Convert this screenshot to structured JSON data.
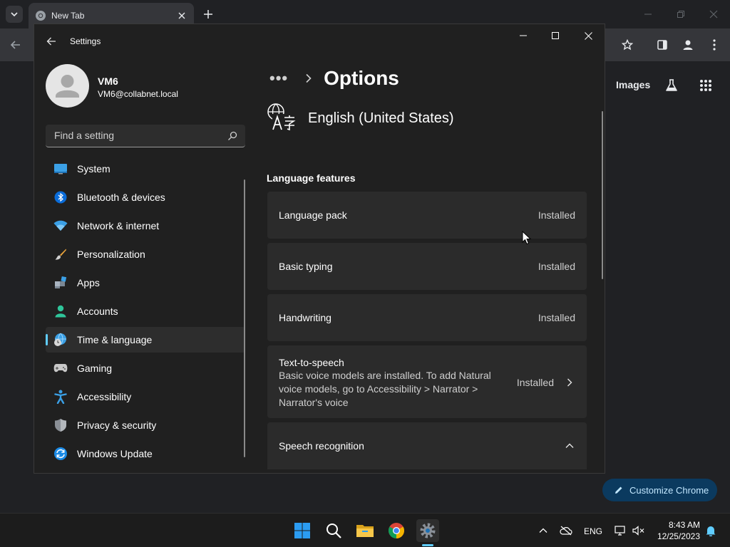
{
  "browser": {
    "tab": {
      "title": "New Tab"
    },
    "ntp": {
      "images_link": "Images",
      "customize_label": "Customize Chrome"
    }
  },
  "settings": {
    "title": "Settings",
    "profile": {
      "name": "VM6",
      "email": "VM6@collabnet.local"
    },
    "search": {
      "placeholder": "Find a setting"
    },
    "nav": [
      {
        "label": "System",
        "icon": "system-icon"
      },
      {
        "label": "Bluetooth & devices",
        "icon": "bluetooth-icon"
      },
      {
        "label": "Network & internet",
        "icon": "wifi-icon"
      },
      {
        "label": "Personalization",
        "icon": "brush-icon"
      },
      {
        "label": "Apps",
        "icon": "apps-icon"
      },
      {
        "label": "Accounts",
        "icon": "accounts-icon"
      },
      {
        "label": "Time & language",
        "icon": "time-language-icon",
        "selected": true
      },
      {
        "label": "Gaming",
        "icon": "gamepad-icon"
      },
      {
        "label": "Accessibility",
        "icon": "accessibility-icon"
      },
      {
        "label": "Privacy & security",
        "icon": "shield-icon"
      },
      {
        "label": "Windows Update",
        "icon": "update-icon"
      }
    ],
    "breadcrumb": {
      "ellipsis": "•••",
      "page_title": "Options"
    },
    "language": {
      "name": "English (United States)"
    },
    "section_title": "Language features",
    "features": [
      {
        "label": "Language pack",
        "status": "Installed"
      },
      {
        "label": "Basic typing",
        "status": "Installed"
      },
      {
        "label": "Handwriting",
        "status": "Installed"
      },
      {
        "label": "Text-to-speech",
        "description": "Basic voice models are installed. To add Natural voice models, go to Accessibility > Narrator > Narrator's voice",
        "status": "Installed"
      },
      {
        "label": "Speech recognition"
      }
    ]
  },
  "taskbar": {
    "tray_language": "ENG",
    "time": "8:43 AM",
    "date": "12/25/2023"
  },
  "colors": {
    "accent": "#60cdff",
    "window_bg": "#202020",
    "card_bg": "#2b2b2b"
  }
}
